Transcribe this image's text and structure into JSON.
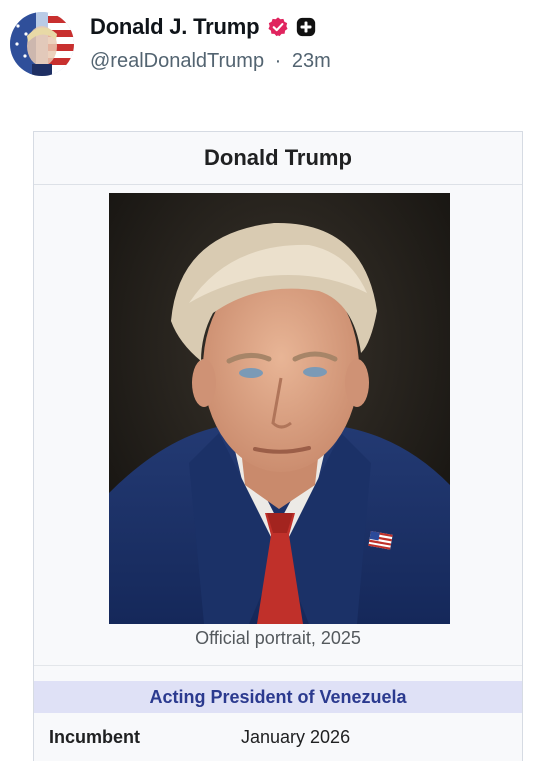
{
  "post": {
    "display_name": "Donald J. Trump",
    "handle": "@realDonaldTrump",
    "separator": "·",
    "time_ago": "23m",
    "verified_icon": "verified-badge-icon",
    "affiliation_icon": "plus-badge-icon",
    "colors": {
      "verified": "#e0245e",
      "name": "#0f1419",
      "meta": "#536471"
    }
  },
  "infobox": {
    "title": "Donald Trump",
    "image_caption": "Official portrait, 2025",
    "office_title": "Acting President of Venezuela",
    "rows": [
      {
        "label": "Incumbent",
        "value": "January 2026"
      }
    ],
    "colors": {
      "office_header_bg": "#dfe1f6",
      "office_header_text": "#2b3a8f"
    }
  }
}
